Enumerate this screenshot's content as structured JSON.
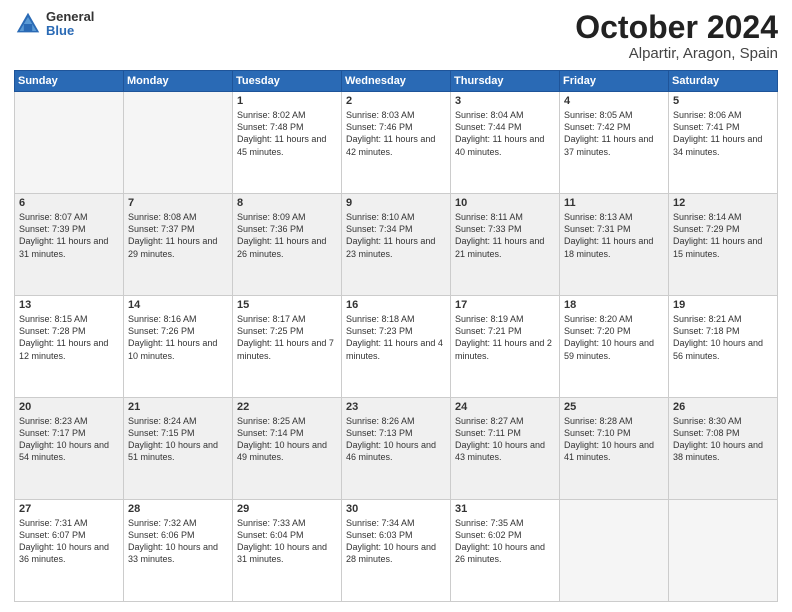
{
  "header": {
    "logo_general": "General",
    "logo_blue": "Blue",
    "month": "October 2024",
    "location": "Alpartir, Aragon, Spain"
  },
  "weekdays": [
    "Sunday",
    "Monday",
    "Tuesday",
    "Wednesday",
    "Thursday",
    "Friday",
    "Saturday"
  ],
  "weeks": [
    [
      {
        "day": "",
        "info": ""
      },
      {
        "day": "",
        "info": ""
      },
      {
        "day": "1",
        "info": "Sunrise: 8:02 AM\nSunset: 7:48 PM\nDaylight: 11 hours and 45 minutes."
      },
      {
        "day": "2",
        "info": "Sunrise: 8:03 AM\nSunset: 7:46 PM\nDaylight: 11 hours and 42 minutes."
      },
      {
        "day": "3",
        "info": "Sunrise: 8:04 AM\nSunset: 7:44 PM\nDaylight: 11 hours and 40 minutes."
      },
      {
        "day": "4",
        "info": "Sunrise: 8:05 AM\nSunset: 7:42 PM\nDaylight: 11 hours and 37 minutes."
      },
      {
        "day": "5",
        "info": "Sunrise: 8:06 AM\nSunset: 7:41 PM\nDaylight: 11 hours and 34 minutes."
      }
    ],
    [
      {
        "day": "6",
        "info": "Sunrise: 8:07 AM\nSunset: 7:39 PM\nDaylight: 11 hours and 31 minutes."
      },
      {
        "day": "7",
        "info": "Sunrise: 8:08 AM\nSunset: 7:37 PM\nDaylight: 11 hours and 29 minutes."
      },
      {
        "day": "8",
        "info": "Sunrise: 8:09 AM\nSunset: 7:36 PM\nDaylight: 11 hours and 26 minutes."
      },
      {
        "day": "9",
        "info": "Sunrise: 8:10 AM\nSunset: 7:34 PM\nDaylight: 11 hours and 23 minutes."
      },
      {
        "day": "10",
        "info": "Sunrise: 8:11 AM\nSunset: 7:33 PM\nDaylight: 11 hours and 21 minutes."
      },
      {
        "day": "11",
        "info": "Sunrise: 8:13 AM\nSunset: 7:31 PM\nDaylight: 11 hours and 18 minutes."
      },
      {
        "day": "12",
        "info": "Sunrise: 8:14 AM\nSunset: 7:29 PM\nDaylight: 11 hours and 15 minutes."
      }
    ],
    [
      {
        "day": "13",
        "info": "Sunrise: 8:15 AM\nSunset: 7:28 PM\nDaylight: 11 hours and 12 minutes."
      },
      {
        "day": "14",
        "info": "Sunrise: 8:16 AM\nSunset: 7:26 PM\nDaylight: 11 hours and 10 minutes."
      },
      {
        "day": "15",
        "info": "Sunrise: 8:17 AM\nSunset: 7:25 PM\nDaylight: 11 hours and 7 minutes."
      },
      {
        "day": "16",
        "info": "Sunrise: 8:18 AM\nSunset: 7:23 PM\nDaylight: 11 hours and 4 minutes."
      },
      {
        "day": "17",
        "info": "Sunrise: 8:19 AM\nSunset: 7:21 PM\nDaylight: 11 hours and 2 minutes."
      },
      {
        "day": "18",
        "info": "Sunrise: 8:20 AM\nSunset: 7:20 PM\nDaylight: 10 hours and 59 minutes."
      },
      {
        "day": "19",
        "info": "Sunrise: 8:21 AM\nSunset: 7:18 PM\nDaylight: 10 hours and 56 minutes."
      }
    ],
    [
      {
        "day": "20",
        "info": "Sunrise: 8:23 AM\nSunset: 7:17 PM\nDaylight: 10 hours and 54 minutes."
      },
      {
        "day": "21",
        "info": "Sunrise: 8:24 AM\nSunset: 7:15 PM\nDaylight: 10 hours and 51 minutes."
      },
      {
        "day": "22",
        "info": "Sunrise: 8:25 AM\nSunset: 7:14 PM\nDaylight: 10 hours and 49 minutes."
      },
      {
        "day": "23",
        "info": "Sunrise: 8:26 AM\nSunset: 7:13 PM\nDaylight: 10 hours and 46 minutes."
      },
      {
        "day": "24",
        "info": "Sunrise: 8:27 AM\nSunset: 7:11 PM\nDaylight: 10 hours and 43 minutes."
      },
      {
        "day": "25",
        "info": "Sunrise: 8:28 AM\nSunset: 7:10 PM\nDaylight: 10 hours and 41 minutes."
      },
      {
        "day": "26",
        "info": "Sunrise: 8:30 AM\nSunset: 7:08 PM\nDaylight: 10 hours and 38 minutes."
      }
    ],
    [
      {
        "day": "27",
        "info": "Sunrise: 7:31 AM\nSunset: 6:07 PM\nDaylight: 10 hours and 36 minutes."
      },
      {
        "day": "28",
        "info": "Sunrise: 7:32 AM\nSunset: 6:06 PM\nDaylight: 10 hours and 33 minutes."
      },
      {
        "day": "29",
        "info": "Sunrise: 7:33 AM\nSunset: 6:04 PM\nDaylight: 10 hours and 31 minutes."
      },
      {
        "day": "30",
        "info": "Sunrise: 7:34 AM\nSunset: 6:03 PM\nDaylight: 10 hours and 28 minutes."
      },
      {
        "day": "31",
        "info": "Sunrise: 7:35 AM\nSunset: 6:02 PM\nDaylight: 10 hours and 26 minutes."
      },
      {
        "day": "",
        "info": ""
      },
      {
        "day": "",
        "info": ""
      }
    ]
  ]
}
